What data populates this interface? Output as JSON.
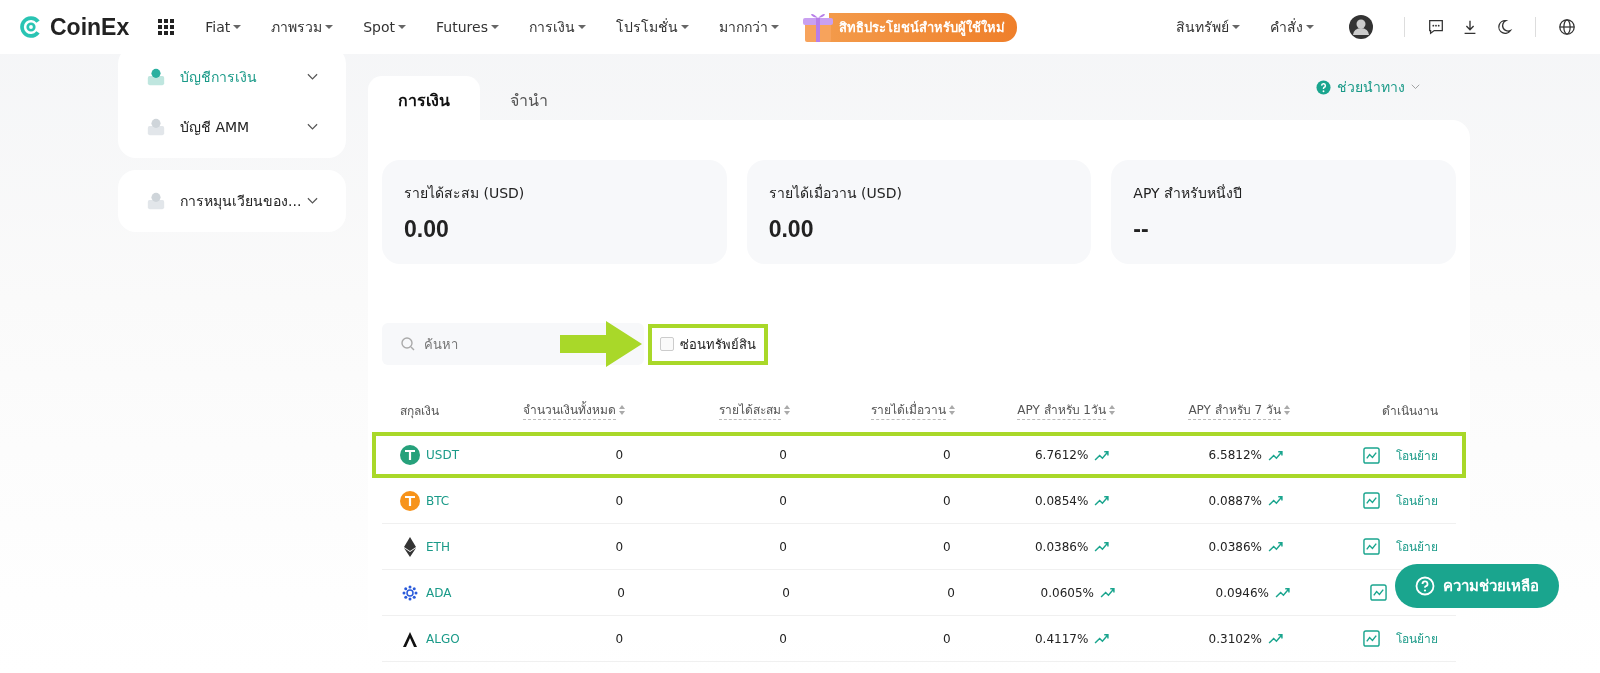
{
  "nav": {
    "brand": "CoinEx",
    "menu": [
      {
        "label": "Fiat",
        "dropdown": true
      },
      {
        "label": "ภาพรวม",
        "dropdown": true
      },
      {
        "label": "Spot",
        "dropdown": true
      },
      {
        "label": "Futures",
        "dropdown": true
      },
      {
        "label": "การเงิน",
        "dropdown": true
      },
      {
        "label": "โปรโมชั่น",
        "dropdown": true
      },
      {
        "label": "มากกว่า",
        "dropdown": true
      }
    ],
    "promo": "สิทธิประโยชน์สำหรับผู้ใช้ใหม่",
    "right": [
      {
        "label": "สินทรัพย์",
        "dropdown": true
      },
      {
        "label": "คำสั่ง",
        "dropdown": true
      }
    ]
  },
  "sidebar": {
    "groups": [
      {
        "items": [
          {
            "label": "บัญชีการเงิน",
            "selected": true,
            "expanded": false
          },
          {
            "label": "บัญชี AMM",
            "selected": false,
            "expanded": false
          }
        ]
      },
      {
        "items": [
          {
            "label": "การหมุนเวียนของ...",
            "selected": false,
            "expanded": false
          }
        ]
      }
    ]
  },
  "tabs": [
    {
      "label": "การเงิน",
      "selected": true
    },
    {
      "label": "จำนำ",
      "selected": false
    }
  ],
  "guide": "ช่วยนำทาง",
  "stats": [
    {
      "label": "รายได้สะสม (USD)",
      "value": "0.00"
    },
    {
      "label": "รายได้เมื่อวาน (USD)",
      "value": "0.00"
    },
    {
      "label": "APY สำหรับหนึ่งปี",
      "value": "--"
    }
  ],
  "search": {
    "placeholder": "ค้นหา"
  },
  "hide_assets": {
    "label": "ซ่อนทรัพย์สิน",
    "checked": false,
    "highlighted": true
  },
  "table": {
    "columns": [
      {
        "label": "สกุลเงิน",
        "sortable": false
      },
      {
        "label": "จำนวนเงินทั้งหมด",
        "sortable": true
      },
      {
        "label": "รายได้สะสม",
        "sortable": true
      },
      {
        "label": "รายได้เมื่อวาน",
        "sortable": true
      },
      {
        "label": "APY สำหรับ 1วัน",
        "sortable": true
      },
      {
        "label": "APY สำหรับ 7 วัน",
        "sortable": true
      },
      {
        "label": "ดำเนินงาน",
        "sortable": false
      }
    ],
    "rows": [
      {
        "coin": "USDT",
        "kind": "circle",
        "color": "#26a17b",
        "total": "0",
        "earned": "0",
        "yesterday": "0",
        "apy1": "6.7612%",
        "apy7": "6.5812%",
        "action": "โอนย้าย",
        "highlighted": true
      },
      {
        "coin": "BTC",
        "kind": "circle",
        "color": "#f7931a",
        "total": "0",
        "earned": "0",
        "yesterday": "0",
        "apy1": "0.0854%",
        "apy7": "0.0887%",
        "action": "โอนย้าย",
        "highlighted": false
      },
      {
        "coin": "ETH",
        "kind": "diamond",
        "color": "#343434",
        "total": "0",
        "earned": "0",
        "yesterday": "0",
        "apy1": "0.0386%",
        "apy7": "0.0386%",
        "action": "โอนย้าย",
        "highlighted": false
      },
      {
        "coin": "ADA",
        "kind": "dots",
        "color": "#2a5ada",
        "total": "0",
        "earned": "0",
        "yesterday": "0",
        "apy1": "0.0605%",
        "apy7": "0.0946%",
        "highlighted": false
      },
      {
        "coin": "ALGO",
        "kind": "slash",
        "color": "#111111",
        "total": "0",
        "earned": "0",
        "yesterday": "0",
        "apy1": "0.4117%",
        "apy7": "0.3102%",
        "action": "โอนย้าย",
        "highlighted": false
      }
    ]
  },
  "help_button": "ความช่วยเหลือ"
}
